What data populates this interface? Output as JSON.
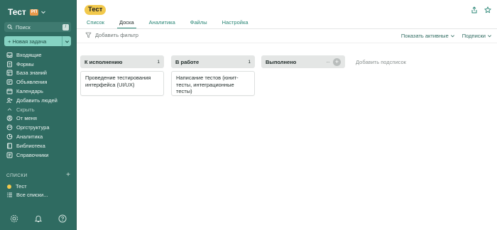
{
  "sidebar": {
    "workspace_name": "Тест",
    "workspace_badge": "РП",
    "search_label": "Поиск",
    "search_shortcut": "/",
    "new_task_label": "+ Новая задача",
    "items": [
      {
        "label": "Входящие",
        "icon": "inbox-icon"
      },
      {
        "label": "Формы",
        "icon": "forms-icon"
      },
      {
        "label": "База знаний",
        "icon": "knowledge-base-icon"
      },
      {
        "label": "Объявления",
        "icon": "announcements-icon"
      },
      {
        "label": "Календарь",
        "icon": "calendar-icon"
      },
      {
        "label": "Добавить людей",
        "icon": "add-people-icon"
      },
      {
        "label": "Скрыть",
        "icon": "collapse-icon"
      },
      {
        "label": "От меня",
        "icon": "from-me-icon"
      },
      {
        "label": "Оргструктура",
        "icon": "org-structure-icon"
      },
      {
        "label": "Аналитика",
        "icon": "analytics-icon"
      },
      {
        "label": "Библиотека",
        "icon": "library-icon"
      },
      {
        "label": "Справочники",
        "icon": "directories-icon"
      }
    ],
    "lists_heading": "СПИСКИ",
    "lists": [
      {
        "label": "Тест",
        "color": "#f2c94c"
      },
      {
        "label": "Все списки..."
      }
    ],
    "bottom_icons": [
      "settings-icon",
      "bell-icon",
      "help-icon"
    ]
  },
  "header": {
    "title": "Тест",
    "tabs": [
      {
        "label": "Список",
        "active": false
      },
      {
        "label": "Доска",
        "active": true
      },
      {
        "label": "Аналитика",
        "active": false
      },
      {
        "label": "Файлы",
        "active": false
      },
      {
        "label": "Настройка",
        "active": false
      }
    ],
    "filter_label": "Добавить фильтр",
    "show_active_label": "Показать активные",
    "subscriptions_label": "Подписки"
  },
  "board": {
    "columns": [
      {
        "title": "К исполнению",
        "count": "1",
        "cards": [
          "Проведение тестирования интерфейса (UI/UX)"
        ]
      },
      {
        "title": "В работе",
        "count": "1",
        "cards": [
          "Написание тестов (юнит-тесты, интеграционные тесты)"
        ]
      },
      {
        "title": "Выполнено",
        "count": "",
        "cards": []
      }
    ],
    "add_list_label": "Добавить подсписок"
  },
  "colors": {
    "sidebar_bg": "#2f6b61",
    "accent": "#2a8676",
    "new_task_bg": "#86d3c3",
    "title_pill": "#f2c94c",
    "badge": "#e89a4c"
  }
}
